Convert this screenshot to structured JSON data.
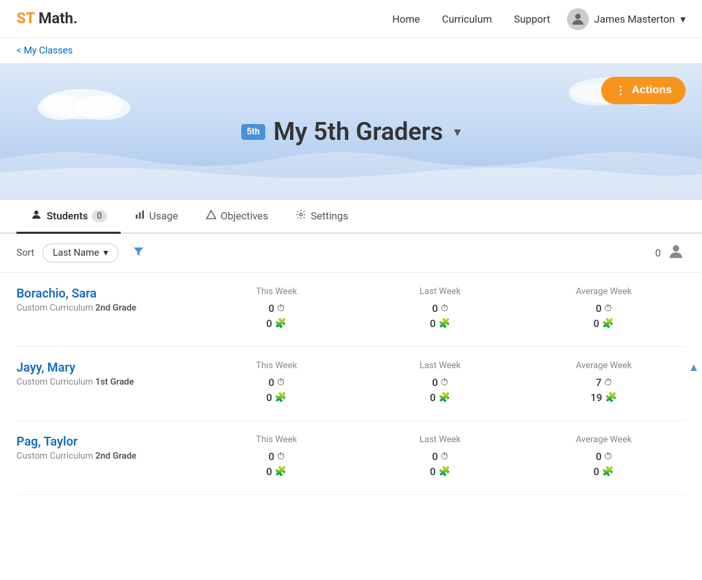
{
  "app": {
    "logo_st": "ST",
    "logo_math": " Math."
  },
  "nav": {
    "home": "Home",
    "curriculum": "Curriculum",
    "support": "Support",
    "user": "James Masterton"
  },
  "breadcrumb": {
    "label": "< My Classes"
  },
  "hero": {
    "grade_badge": "5th",
    "class_name": "My 5th Graders",
    "actions_label": "Actions",
    "actions_dots": "⋮"
  },
  "tabs": [
    {
      "id": "students",
      "label": "Students",
      "count": "0",
      "active": true,
      "icon": "person-icon"
    },
    {
      "id": "usage",
      "label": "Usage",
      "count": null,
      "active": false,
      "icon": "bar-chart-icon"
    },
    {
      "id": "objectives",
      "label": "Objectives",
      "count": null,
      "active": false,
      "icon": "triangle-icon"
    },
    {
      "id": "settings",
      "label": "Settings",
      "count": null,
      "active": false,
      "icon": "gear-icon"
    }
  ],
  "sort": {
    "label": "Sort",
    "current": "Last Name",
    "filter_icon": "filter-icon",
    "student_count": "0"
  },
  "students": [
    {
      "name": "Borachio, Sara",
      "curriculum": "Custom Curriculum",
      "grade": "2nd Grade",
      "this_week": {
        "time": "0",
        "puzzles": "0"
      },
      "last_week": {
        "time": "0",
        "puzzles": "0"
      },
      "avg_week": {
        "time": "0",
        "puzzles": "0"
      },
      "show_scroll": false
    },
    {
      "name": "Jayy, Mary",
      "curriculum": "Custom Curriculum",
      "grade": "1st Grade",
      "this_week": {
        "time": "0",
        "puzzles": "0"
      },
      "last_week": {
        "time": "0",
        "puzzles": "0"
      },
      "avg_week": {
        "time": "7",
        "puzzles": "19"
      },
      "show_scroll": true
    },
    {
      "name": "Pag, Taylor",
      "curriculum": "Custom Curriculum",
      "grade": "2nd Grade",
      "this_week": {
        "time": "0",
        "puzzles": "0"
      },
      "last_week": {
        "time": "0",
        "puzzles": "0"
      },
      "avg_week": {
        "time": "0",
        "puzzles": "0"
      },
      "show_scroll": false
    }
  ],
  "columns": {
    "this_week": "This Week",
    "last_week": "Last Week",
    "avg_week": "Average Week"
  },
  "icons": {
    "clock": "⏱",
    "puzzle": "🧩",
    "filter": "▼",
    "scroll_up": "▲",
    "dots": "⋮"
  }
}
